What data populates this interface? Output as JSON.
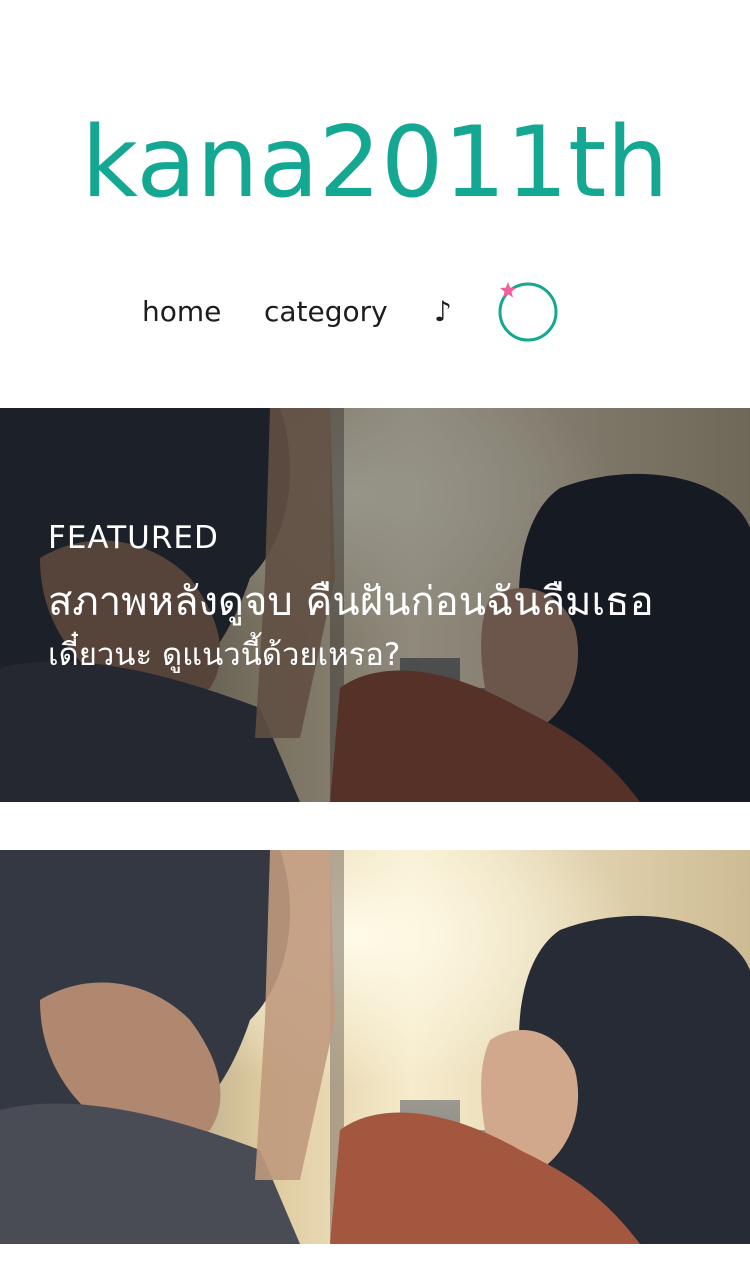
{
  "site": {
    "title": "kana2011th",
    "accent_color": "#14a892"
  },
  "nav": {
    "items": [
      {
        "label": "home"
      },
      {
        "label": "category"
      },
      {
        "label": "♪"
      }
    ],
    "search_icon": "search-ring-icon",
    "search_icon_accent": "#f0609e"
  },
  "featured": {
    "kicker": "FEATURED",
    "title": "สภาพหลังดูจบ คืนฝันก่อนฉันลืมเธอ",
    "subtitle": "เดี๋ยวนะ ดูแนวนี้ด้วยเหรอ?",
    "image": "featured-movie-still"
  },
  "post": {
    "image": "post-movie-still"
  }
}
